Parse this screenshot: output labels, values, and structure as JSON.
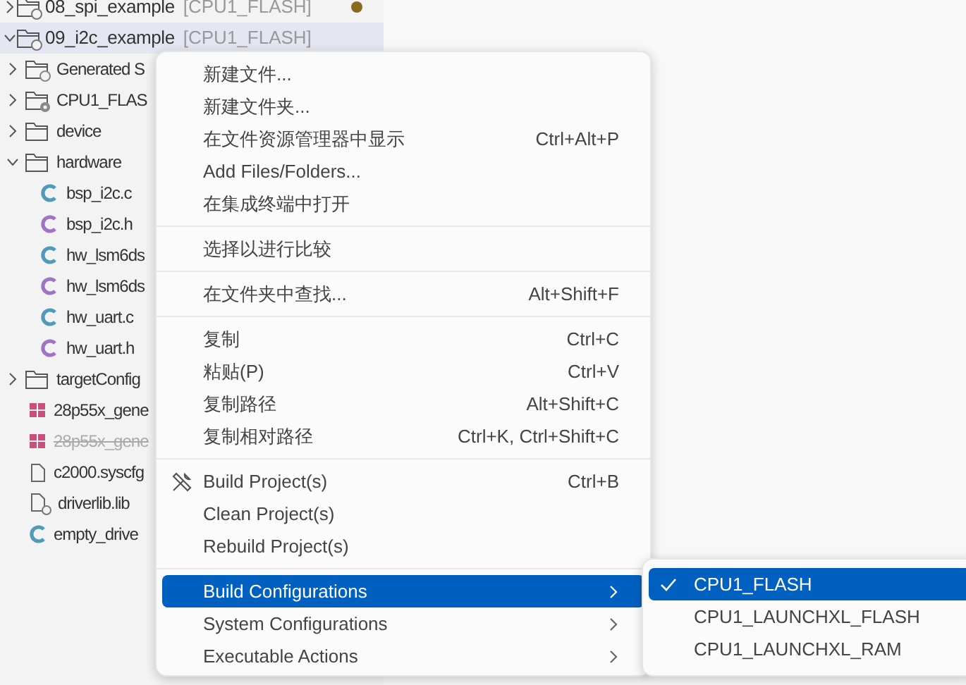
{
  "tree": [
    {
      "kind": "project",
      "label": "08_spi_example",
      "tag": "[CPU1_FLASH]",
      "modified": true,
      "selected": false,
      "expanded": false
    },
    {
      "kind": "project",
      "label": "09_i2c_example",
      "tag": "[CPU1_FLASH]",
      "modified": false,
      "selected": true,
      "expanded": true,
      "children": [
        {
          "kind": "gen-folder",
          "label": "Generated S",
          "expanded": false,
          "selected": false
        },
        {
          "kind": "gear-folder",
          "label": "CPU1_FLAS",
          "expanded": false,
          "selected": false
        },
        {
          "kind": "folder",
          "label": "device",
          "expanded": false,
          "selected": false
        },
        {
          "kind": "folder",
          "label": "hardware",
          "expanded": true,
          "selected": false,
          "children": [
            {
              "kind": "c",
              "label": "bsp_i2c.c",
              "selected": false
            },
            {
              "kind": "h",
              "label": "bsp_i2c.h",
              "selected": false
            },
            {
              "kind": "c",
              "label": "hw_lsm6ds",
              "selected": false
            },
            {
              "kind": "h",
              "label": "hw_lsm6ds",
              "selected": false
            },
            {
              "kind": "c",
              "label": "hw_uart.c",
              "selected": false
            },
            {
              "kind": "h",
              "label": "hw_uart.h",
              "selected": false
            }
          ]
        },
        {
          "kind": "folder",
          "label": "targetConfig",
          "expanded": false,
          "selected": false
        },
        {
          "kind": "grid",
          "label": "28p55x_gene",
          "excluded": false,
          "selected": false
        },
        {
          "kind": "grid",
          "label": "28p55x_gene",
          "excluded": true,
          "selected": false
        },
        {
          "kind": "file",
          "label": "c2000.syscfg",
          "selected": false
        },
        {
          "kind": "lib",
          "label": "driverlib.lib",
          "selected": false
        },
        {
          "kind": "c",
          "label": "empty_drive",
          "selected": false
        }
      ]
    }
  ],
  "context_menu": [
    {
      "kind": "item",
      "label": "新建文件..."
    },
    {
      "kind": "item",
      "label": "新建文件夹..."
    },
    {
      "kind": "item",
      "label": "在文件资源管理器中显示",
      "shortcut": "Ctrl+Alt+P"
    },
    {
      "kind": "item",
      "label": "Add Files/Folders..."
    },
    {
      "kind": "item",
      "label": "在集成终端中打开"
    },
    {
      "kind": "separator"
    },
    {
      "kind": "item",
      "label": "选择以进行比较"
    },
    {
      "kind": "separator"
    },
    {
      "kind": "item",
      "label": "在文件夹中查找...",
      "shortcut": "Alt+Shift+F"
    },
    {
      "kind": "separator"
    },
    {
      "kind": "item",
      "label": "复制",
      "shortcut": "Ctrl+C"
    },
    {
      "kind": "item",
      "label": "粘贴(P)",
      "shortcut": "Ctrl+V"
    },
    {
      "kind": "item",
      "label": "复制路径",
      "shortcut": "Alt+Shift+C"
    },
    {
      "kind": "item",
      "label": "复制相对路径",
      "shortcut": "Ctrl+K, Ctrl+Shift+C"
    },
    {
      "kind": "separator"
    },
    {
      "kind": "build-item",
      "label": "Build Project(s)",
      "shortcut": "Ctrl+B"
    },
    {
      "kind": "item",
      "label": "Clean Project(s)"
    },
    {
      "kind": "item",
      "label": "Rebuild Project(s)"
    },
    {
      "kind": "separator"
    },
    {
      "kind": "submenu",
      "label": "Build Configurations",
      "selected": true
    },
    {
      "kind": "submenu",
      "label": "System Configurations",
      "selected": false
    },
    {
      "kind": "submenu",
      "label": "Executable Actions",
      "selected": false
    }
  ],
  "submenu": [
    {
      "label": "CPU1_FLASH",
      "checked": true,
      "selected": true
    },
    {
      "label": "CPU1_LAUNCHXL_FLASH",
      "checked": false,
      "selected": false
    },
    {
      "label": "CPU1_LAUNCHXL_RAM",
      "checked": false,
      "selected": false
    }
  ]
}
